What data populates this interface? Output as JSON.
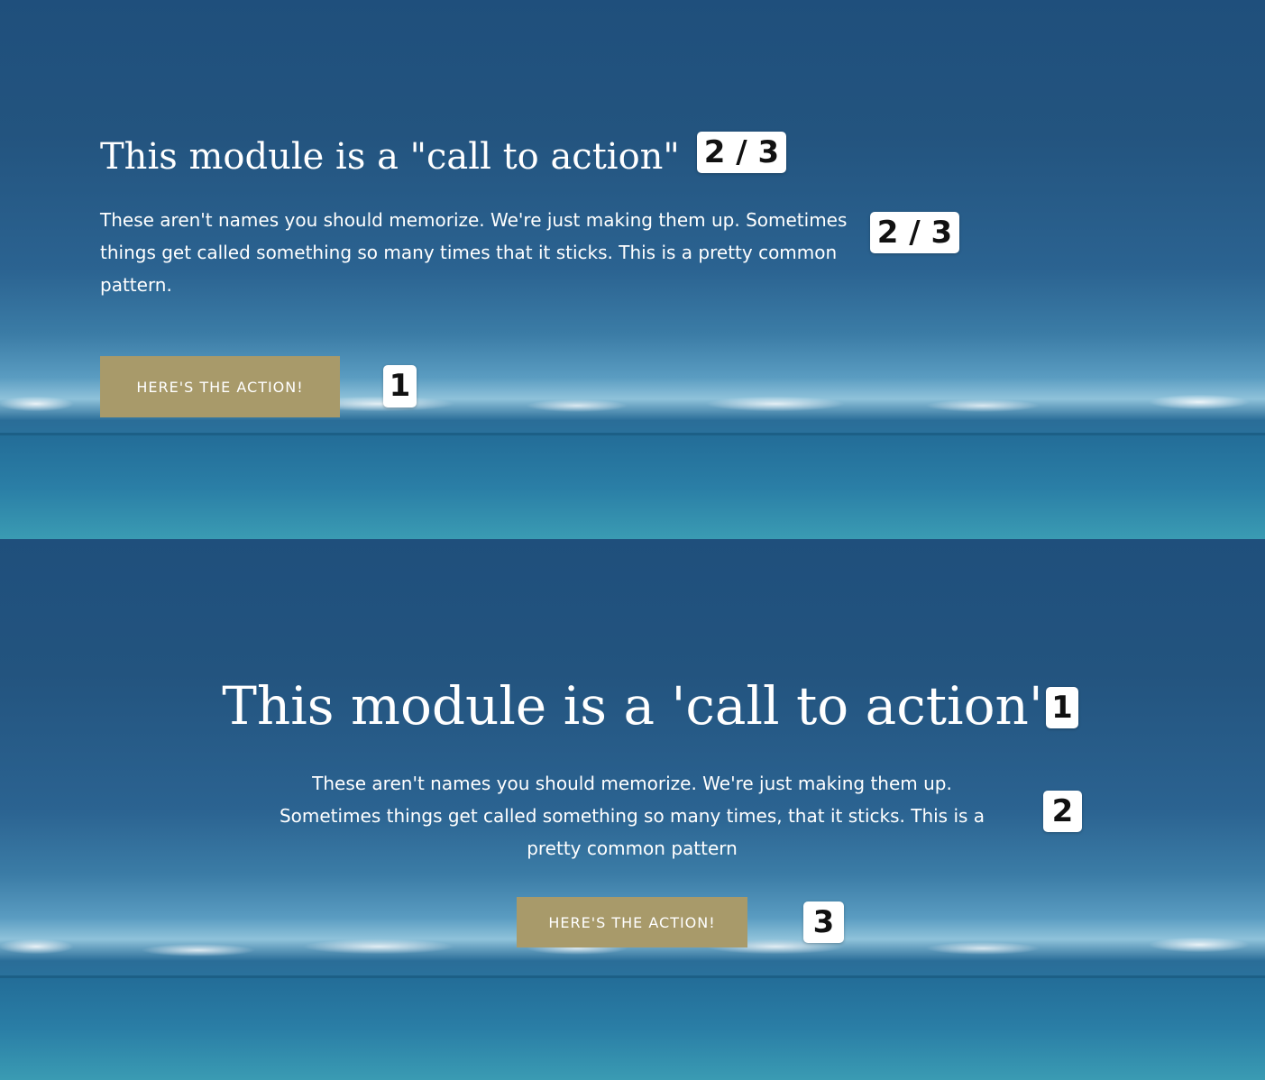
{
  "top_module": {
    "title": "This module is a \"call to action\"",
    "body": "These aren't names you should memorize. We're just making them up. Sometimes things get called something so many times that it sticks. This is a pretty common pattern.",
    "button_label": "HERE'S THE ACTION!",
    "badges": {
      "title": "2 / 3",
      "body": "2 / 3",
      "button": "1"
    }
  },
  "bottom_module": {
    "title": "This module is a 'call to action'",
    "body": "These aren't names you should memorize. We're just making them up. Sometimes things get called something so many times, that it sticks. This is a pretty common pattern",
    "button_label": "HERE'S THE ACTION!",
    "badges": {
      "title": "1",
      "body": "2",
      "button": "3"
    }
  },
  "colors": {
    "sky": "#23547f",
    "sea": "#2a7ea6",
    "button": "#a89a6a",
    "text": "#ffffff",
    "badge_bg": "#ffffff"
  }
}
